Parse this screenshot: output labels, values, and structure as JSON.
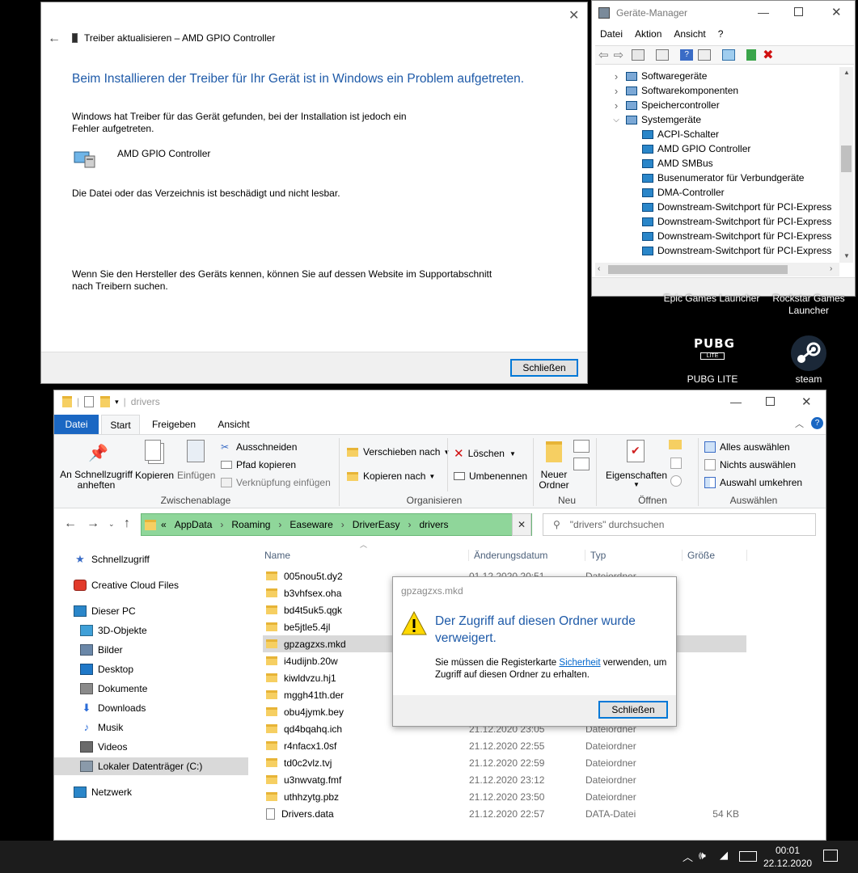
{
  "driver_dialog": {
    "title": "Treiber aktualisieren – AMD GPIO Controller",
    "heading": "Beim Installieren der Treiber für Ihr Gerät ist in Windows ein Problem aufgetreten.",
    "text1": "Windows hat Treiber für das Gerät gefunden, bei der Installation ist jedoch ein Fehler aufgetreten.",
    "device_name": "AMD GPIO Controller",
    "text2": "Die Datei oder das Verzeichnis ist beschädigt und nicht lesbar.",
    "text3": "Wenn Sie den Hersteller des Geräts kennen, können Sie auf dessen Website im Supportabschnitt nach Treibern suchen.",
    "close_label": "Schließen"
  },
  "device_manager": {
    "title": "Geräte-Manager",
    "menu": [
      "Datei",
      "Aktion",
      "Ansicht",
      "?"
    ],
    "tree": [
      {
        "label": "Softwaregeräte",
        "level": 0,
        "expanded": false
      },
      {
        "label": "Softwarekomponenten",
        "level": 0,
        "expanded": false
      },
      {
        "label": "Speichercontroller",
        "level": 0,
        "expanded": false
      },
      {
        "label": "Systemgeräte",
        "level": 0,
        "expanded": true
      },
      {
        "label": "ACPI-Schalter",
        "level": 1
      },
      {
        "label": "AMD GPIO Controller",
        "level": 1
      },
      {
        "label": "AMD SMBus",
        "level": 1
      },
      {
        "label": "Busenumerator für Verbundgeräte",
        "level": 1
      },
      {
        "label": "DMA-Controller",
        "level": 1
      },
      {
        "label": "Downstream-Switchport für PCI-Express",
        "level": 1
      },
      {
        "label": "Downstream-Switchport für PCI-Express",
        "level": 1
      },
      {
        "label": "Downstream-Switchport für PCI-Express",
        "level": 1
      },
      {
        "label": "Downstream-Switchport für PCI-Express",
        "level": 1
      }
    ]
  },
  "desktop": {
    "epic": "Epic Games Launcher",
    "rockstar": "Rockstar Games Launcher",
    "pubg": "PUBG LITE",
    "steam": "steam",
    "pubg_logo": "PUBG"
  },
  "explorer": {
    "title": "drivers",
    "tabs": [
      "Datei",
      "Start",
      "Freigeben",
      "Ansicht"
    ],
    "ribbon": {
      "pin": "An Schnellzugriff anheften",
      "copy": "Kopieren",
      "paste": "Einfügen",
      "cut": "Ausschneiden",
      "copy_path": "Pfad kopieren",
      "paste_link": "Verknüpfung einfügen",
      "group1": "Zwischenablage",
      "move_to": "Verschieben nach",
      "copy_to": "Kopieren nach",
      "delete": "Löschen",
      "rename": "Umbenennen",
      "group2": "Organisieren",
      "new_folder": "Neuer Ordner",
      "group3": "Neu",
      "properties": "Eigenschaften",
      "group4": "Öffnen",
      "select_all": "Alles auswählen",
      "select_none": "Nichts auswählen",
      "invert": "Auswahl umkehren",
      "group5": "Auswählen"
    },
    "address": [
      "AppData",
      "Roaming",
      "Easeware",
      "DriverEasy",
      "drivers"
    ],
    "address_prefix": "«",
    "search_placeholder": "\"drivers\" durchsuchen",
    "nav": [
      {
        "label": "Schnellzugriff",
        "indent": 0,
        "icon": "star"
      },
      {
        "label": "Creative Cloud Files",
        "indent": 0,
        "icon": "cc"
      },
      {
        "label": "Dieser PC",
        "indent": 0,
        "icon": "pc"
      },
      {
        "label": "3D-Objekte",
        "indent": 1,
        "icon": "cube"
      },
      {
        "label": "Bilder",
        "indent": 1,
        "icon": "pic"
      },
      {
        "label": "Desktop",
        "indent": 1,
        "icon": "desk"
      },
      {
        "label": "Dokumente",
        "indent": 1,
        "icon": "doc"
      },
      {
        "label": "Downloads",
        "indent": 1,
        "icon": "down"
      },
      {
        "label": "Musik",
        "indent": 1,
        "icon": "music"
      },
      {
        "label": "Videos",
        "indent": 1,
        "icon": "video"
      },
      {
        "label": "Lokaler Datenträger (C:)",
        "indent": 1,
        "icon": "drive"
      },
      {
        "label": "Netzwerk",
        "indent": 0,
        "icon": "net"
      }
    ],
    "columns": [
      "Name",
      "Änderungsdatum",
      "Typ",
      "Größe"
    ],
    "files": [
      {
        "name": "005nou5t.dy2",
        "date": "01.12.2020 20:51",
        "type": "Dateiordner",
        "size": ""
      },
      {
        "name": "b3vhfsex.oha",
        "date": "",
        "type": "",
        "size": ""
      },
      {
        "name": "bd4t5uk5.qgk",
        "date": "",
        "type": "",
        "size": ""
      },
      {
        "name": "be5jtle5.4jl",
        "date": "",
        "type": "",
        "size": ""
      },
      {
        "name": "gpzagzxs.mkd",
        "date": "",
        "type": "",
        "size": ""
      },
      {
        "name": "i4udijnb.20w",
        "date": "",
        "type": "",
        "size": ""
      },
      {
        "name": "kiwldvzu.hj1",
        "date": "",
        "type": "",
        "size": ""
      },
      {
        "name": "mggh41th.der",
        "date": "",
        "type": "",
        "size": ""
      },
      {
        "name": "obu4jymk.bey",
        "date": "",
        "type": "",
        "size": ""
      },
      {
        "name": "qd4bqahq.ich",
        "date": "21.12.2020 23:05",
        "type": "Dateiordner",
        "size": ""
      },
      {
        "name": "r4nfacx1.0sf",
        "date": "21.12.2020 22:55",
        "type": "Dateiordner",
        "size": ""
      },
      {
        "name": "td0c2vlz.tvj",
        "date": "21.12.2020 22:59",
        "type": "Dateiordner",
        "size": ""
      },
      {
        "name": "u3nwvatg.fmf",
        "date": "21.12.2020 23:12",
        "type": "Dateiordner",
        "size": ""
      },
      {
        "name": "uthhzytg.pbz",
        "date": "21.12.2020 23:50",
        "type": "Dateiordner",
        "size": ""
      },
      {
        "name": "Drivers.data",
        "date": "21.12.2020 22:57",
        "type": "DATA-Datei",
        "size": "54 KB"
      }
    ]
  },
  "access_dialog": {
    "title": "gpzagzxs.mkd",
    "heading": "Der Zugriff auf diesen Ordner wurde verweigert.",
    "text_before": "Sie müssen die Registerkarte ",
    "link": "Sicherheit",
    "text_after": " verwenden, um Zugriff auf diesen Ordner zu erhalten.",
    "close_label": "Schließen"
  },
  "taskbar": {
    "time": "00:01",
    "date": "22.12.2020"
  },
  "colors": {
    "accent": "#0078d7",
    "heading_blue": "#1e5aa8",
    "address_green": "#8fd69a",
    "ribbon_bg": "#f5f6f7"
  }
}
